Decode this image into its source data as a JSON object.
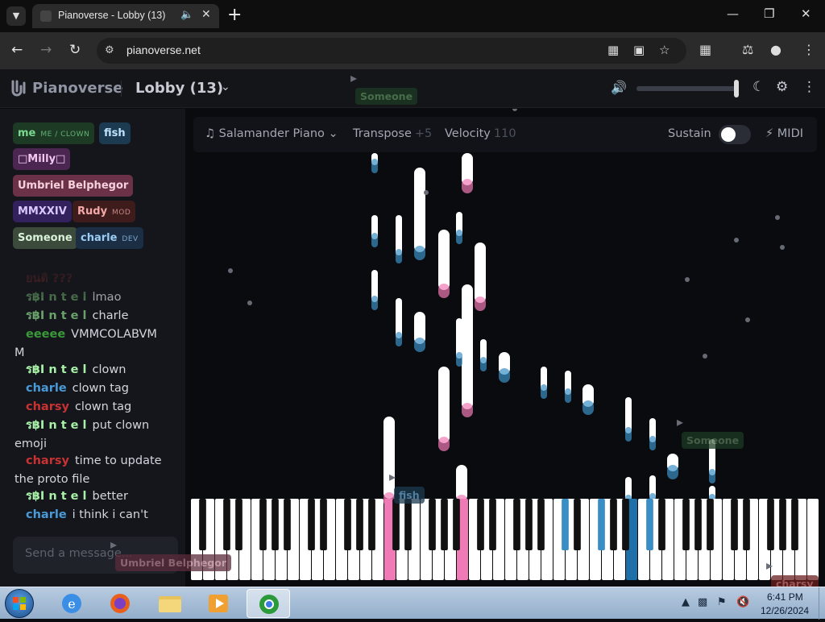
{
  "browser": {
    "tab_title": "Pianoverse - Lobby (13)",
    "url": "pianoverse.net"
  },
  "header": {
    "logo": "Pianoverse",
    "room": "Lobby (13)",
    "volume_percent": 100
  },
  "users": [
    {
      "name": "me",
      "badge": "ME / CLOWN",
      "color": "#7bd88f",
      "bg": "#1d3a24"
    },
    {
      "name": "fish",
      "badge": "",
      "color": "#bfe3ff",
      "bg": "#1c3a50"
    },
    {
      "name": "□Milly□",
      "badge": "",
      "color": "#f1c7f1",
      "bg": "#4a2650"
    },
    {
      "name": "Umbriel Belphegor",
      "badge": "",
      "color": "#f6d1dc",
      "bg": "#6b3147"
    },
    {
      "name": "MMXXIV",
      "badge": "",
      "color": "#d8c8ff",
      "bg": "#33215e"
    },
    {
      "name": "Rudy",
      "badge": "MOD",
      "color": "#f4a8a8",
      "bg": "#3e1c1c"
    },
    {
      "name": "Someone",
      "badge": "",
      "color": "#d9f2d9",
      "bg": "#3b4a3b"
    },
    {
      "name": "charle",
      "badge": "DEV",
      "color": "#9ccdf5",
      "bg": "#1b2e44"
    }
  ],
  "chat": [
    {
      "nick": "ยนติ ???",
      "msg": "",
      "color": "#7a2a2a"
    },
    {
      "nick": "ร฿I n t e l",
      "msg": "lmao",
      "color": "#5a8a5a"
    },
    {
      "nick": "ร฿I n t e l",
      "msg": "charle",
      "color": "#6aa06a"
    },
    {
      "nick": "eeeee",
      "msg": "VMMCOLABVM",
      "wrap": "M",
      "color": "#3a9a3a"
    },
    {
      "nick": "ร฿I n t e l",
      "msg": "clown",
      "color": "#a8f0a8"
    },
    {
      "nick": "charle",
      "msg": "clown tag",
      "color": "#4a9ad8"
    },
    {
      "nick": "charsy",
      "msg": "clown tag",
      "color": "#c83232"
    },
    {
      "nick": "ร฿I n t e l",
      "msg": "put clown",
      "wrap": "emoji",
      "color": "#a8f0a8"
    },
    {
      "nick": "charsy",
      "msg": "time to update",
      "wrap": "the proto file",
      "color": "#c83232"
    },
    {
      "nick": "ร฿I n t e l",
      "msg": "better",
      "color": "#a8f0a8"
    },
    {
      "nick": "charle",
      "msg": "i think i can't",
      "color": "#4a9ad8"
    }
  ],
  "chat_input": {
    "placeholder": "Send a message..."
  },
  "controls": {
    "instrument": "Salamander Piano",
    "transpose_label": "Transpose",
    "transpose_value": "+5",
    "velocity_label": "Velocity",
    "velocity_value": "110",
    "sustain_label": "Sustain",
    "midi_label": "MIDI"
  },
  "cursors": [
    {
      "name": "Someone",
      "bg": "#1c3a24",
      "color": "#5a8a5a"
    },
    {
      "name": "Someone",
      "bg": "#1c3a24",
      "color": "#5a7a5a"
    },
    {
      "name": "fish",
      "bg": "#1c3a50",
      "color": "#6aa6d0"
    },
    {
      "name": "Umbriel Belphegor",
      "bg": "#5a2a3a",
      "color": "#b07a8a"
    },
    {
      "name": "charsy",
      "bg": "#6a2020",
      "color": "#d07070"
    }
  ],
  "taskbar": {
    "time": "6:41 PM",
    "date": "12/26/2024"
  },
  "colors": {
    "pink": "#f07ab5",
    "blue": "#3a8ec4",
    "dark_blue": "#1f6fa8"
  }
}
